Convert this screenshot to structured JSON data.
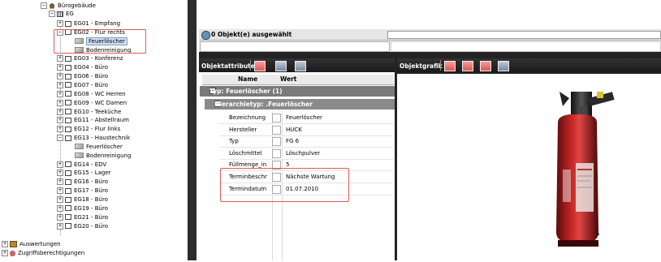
{
  "tree": {
    "root": "Bürogebäude",
    "floor": "EG",
    "items": [
      {
        "label": "EG01 - Empfang",
        "exp": "+"
      },
      {
        "label": "EG02 - Flur rechts",
        "exp": "-"
      },
      {
        "label": "Feuerlöscher",
        "child": true,
        "selected": true
      },
      {
        "label": "Bodenreinigung",
        "child": true
      },
      {
        "label": "EG03 - Konferenz",
        "exp": "+"
      },
      {
        "label": "EG04 - Büro",
        "exp": "+"
      },
      {
        "label": "EG06 - Büro",
        "exp": "+"
      },
      {
        "label": "EG07 - Büro",
        "exp": "+"
      },
      {
        "label": "EG08 - WC Herren",
        "exp": "+"
      },
      {
        "label": "EG09 - WC Damen",
        "exp": "+"
      },
      {
        "label": "EG10 - Teeküche",
        "exp": "+"
      },
      {
        "label": "EG11 - Abstellraum",
        "exp": "+"
      },
      {
        "label": "EG12 - Flur links",
        "exp": "+"
      },
      {
        "label": "EG13 - Haustechnik",
        "exp": "-"
      },
      {
        "label": "Feuerlöscher",
        "child": true
      },
      {
        "label": "Bodenreinigung",
        "child": true
      },
      {
        "label": "EG14 - EDV",
        "exp": "+"
      },
      {
        "label": "EG15 - Lager",
        "exp": "+"
      },
      {
        "label": "EG16 - Büro",
        "exp": "+"
      },
      {
        "label": "EG17 - Büro",
        "exp": "+"
      },
      {
        "label": "EG18 - Büro",
        "exp": "+"
      },
      {
        "label": "EG19 - Büro",
        "exp": "+"
      },
      {
        "label": "EG21 - Büro",
        "exp": "+"
      },
      {
        "label": "EG20 - Büro",
        "exp": "+"
      }
    ],
    "bottom": [
      "Auswertungen",
      "Zugriffsberechtigungen"
    ]
  },
  "selection": {
    "text": "0 Objekt(e) ausgewählt"
  },
  "attributes": {
    "title": "Objektattribute",
    "col_name": "Name",
    "col_value": "Wert",
    "group_type": "Typ: Feuerlöscher (1)",
    "group_hier": "Hierarchietyp: .Feuerlöscher",
    "rows": [
      {
        "name": "Bezeichnung",
        "value": "Feuerlöscher"
      },
      {
        "name": "Hersteller",
        "value": "HUCK"
      },
      {
        "name": "Typ",
        "value": "FG 6"
      },
      {
        "name": "Löschmittel",
        "value": "Löschpulver"
      },
      {
        "name": "Füllmenge_in",
        "value": "5"
      },
      {
        "name": "Terminbeschr",
        "value": "Nächste Wartung"
      },
      {
        "name": "Termindatum",
        "value": "01.07.2010"
      }
    ]
  },
  "graphic": {
    "title": "Objektgrafik"
  },
  "icons": [
    "house-icon",
    "floor-icon",
    "room-icon",
    "extinguisher-object-icon",
    "evaluation-icon",
    "access-rights-icon",
    "selection-icon"
  ],
  "colors": {
    "highlight_box": "#e05a5a",
    "dark_bg": "#232323",
    "extinguisher_red": "#b01e1e"
  }
}
